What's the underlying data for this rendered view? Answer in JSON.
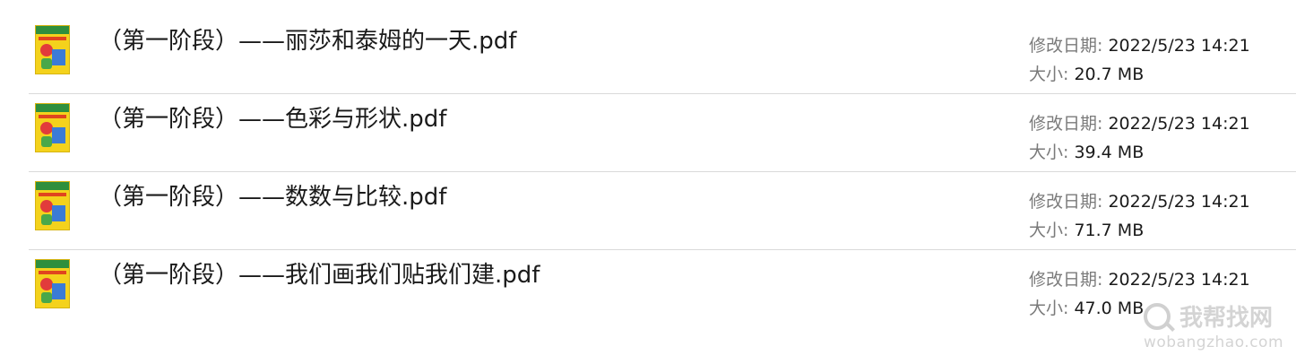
{
  "files": [
    {
      "name": "（第一阶段）——丽莎和泰姆的一天.pdf",
      "modified_label": "修改日期:",
      "modified_value": "2022/5/23 14:21",
      "size_label": "大小:",
      "size_value": "20.7 MB",
      "icon": "pdf-thumbnail-icon"
    },
    {
      "name": "（第一阶段）——色彩与形状.pdf",
      "modified_label": "修改日期:",
      "modified_value": "2022/5/23 14:21",
      "size_label": "大小:",
      "size_value": "39.4 MB",
      "icon": "pdf-thumbnail-icon"
    },
    {
      "name": "（第一阶段）——数数与比较.pdf",
      "modified_label": "修改日期:",
      "modified_value": "2022/5/23 14:21",
      "size_label": "大小:",
      "size_value": "71.7 MB",
      "icon": "pdf-thumbnail-icon"
    },
    {
      "name": "（第一阶段）——我们画我们贴我们建.pdf",
      "modified_label": "修改日期:",
      "modified_value": "2022/5/23 14:21",
      "size_label": "大小:",
      "size_value": "47.0 MB",
      "icon": "pdf-thumbnail-icon"
    }
  ],
  "watermark": {
    "text": "我帮找网",
    "url": "wobangzhao.com",
    "icon": "magnifier-icon"
  },
  "colors": {
    "separator": "#d9d9d9",
    "label_gray": "#7a7a7a",
    "text": "#1a1a1a",
    "thumb_yellow": "#f4d21c"
  }
}
